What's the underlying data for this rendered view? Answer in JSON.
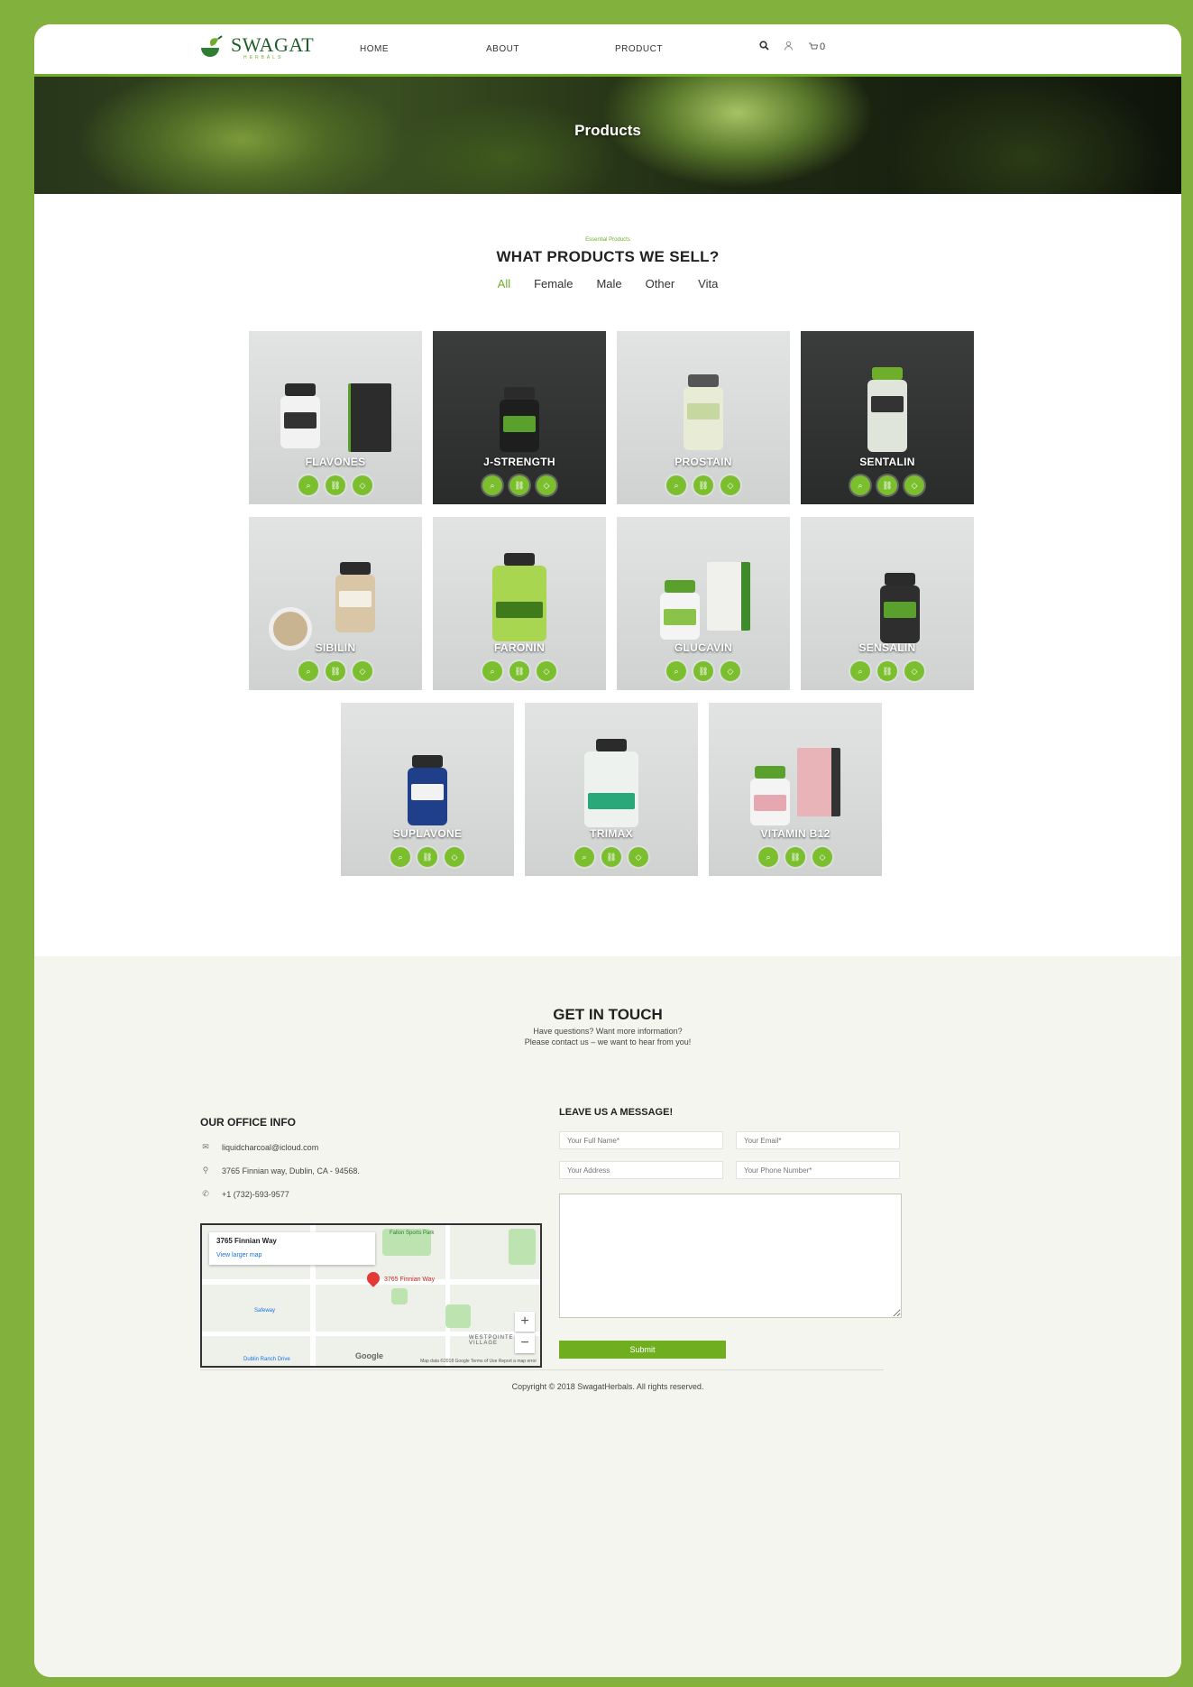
{
  "brand": {
    "name": "SWAGAT",
    "sub": "HERBALS"
  },
  "nav": {
    "links": [
      "HOME",
      "ABOUT",
      "PRODUCT"
    ],
    "cart_count": "0"
  },
  "hero": {
    "title": "Products"
  },
  "products_section": {
    "eyebrow": "Essential Products",
    "title": "WHAT PRODUCTS WE SELL?",
    "filters": [
      "All",
      "Female",
      "Male",
      "Other",
      "Vita"
    ],
    "active_filter": "All"
  },
  "products": [
    {
      "name": "FLAVONES"
    },
    {
      "name": "J-STRENGTH"
    },
    {
      "name": "PROSTAIN"
    },
    {
      "name": "SENTALIN"
    },
    {
      "name": "SIBILIN"
    },
    {
      "name": "FARONIN"
    },
    {
      "name": "GLUCAVIN"
    },
    {
      "name": "SENSALIN"
    },
    {
      "name": "SUPLAVONE"
    },
    {
      "name": "TRIMAX"
    },
    {
      "name": "VITAMIN B12"
    }
  ],
  "contact": {
    "title": "GET IN TOUCH",
    "subtitle_1": "Have questions? Want more information?",
    "subtitle_2": "Please contact us – we want to hear from you!",
    "office_title": "OUR OFFICE INFO",
    "email": "liquidcharcoal@icloud.com",
    "address": "3765 Finnian way, Dublin, CA - 94568.",
    "phone": "+1 (732)-593-9577",
    "map": {
      "place": "3765 Finnian Way",
      "link": "View larger map",
      "pin_label": "3765 Finnian Way",
      "areas": [
        "Fallon Sports Park",
        "Safeway",
        "WESTPOINTE VILLAGE",
        "Dublin Ranch Drive"
      ],
      "logo": "Google",
      "footer": "Map data ©2018 Google   Terms of Use   Report a map error"
    },
    "message_title": "LEAVE US A MESSAGE!",
    "placeholders": {
      "name": "Your Full Name*",
      "email": "Your Email*",
      "address": "Your Address",
      "phone": "Your Phone Number*"
    },
    "submit": "Submit"
  },
  "footer": {
    "copyright": "Copyright © 2018 SwagatHerbals. All rights reserved."
  }
}
